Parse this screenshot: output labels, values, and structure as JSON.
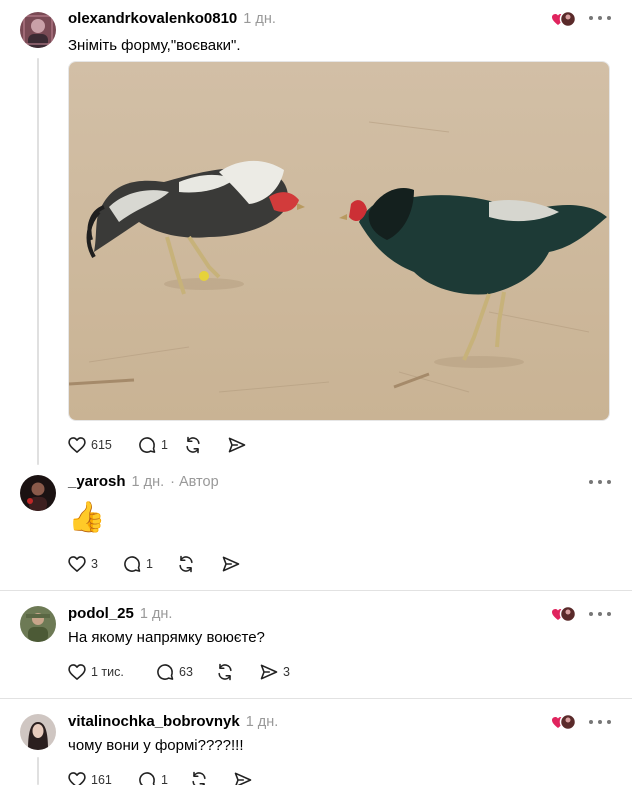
{
  "colors": {
    "username": "#000000",
    "meta": "#999999",
    "icon": "#222222",
    "heart_red": "#e0245e",
    "divider": "#e2e2e2"
  },
  "posts": [
    {
      "username": "olexandrkovalenko0810",
      "time": "1 дн.",
      "text": "Зніміть форму,\"воєваки\".",
      "image_alt": "two roosters fighting on sandy ground",
      "liked_by_author": true,
      "actions": {
        "likes": "615",
        "replies": "1",
        "reposts": "",
        "shares": ""
      }
    },
    {
      "username": "_yarosh",
      "time": "1 дн.",
      "author_tag": "· Автор",
      "emoji": "👍",
      "actions": {
        "likes": "3",
        "replies": "1",
        "reposts": "",
        "shares": ""
      }
    },
    {
      "username": "podol_25",
      "time": "1 дн.",
      "text": "На якому напрямку воюєте?",
      "liked_by_author": true,
      "actions": {
        "likes": "1 тис.",
        "replies": "63",
        "reposts": "",
        "shares": "3"
      }
    },
    {
      "username": "vitalinochka_bobrovnyk",
      "time": "1 дн.",
      "text": "чому вони у формі????!!!",
      "liked_by_author": true,
      "actions": {
        "likes": "161",
        "replies": "1",
        "reposts": "",
        "shares": ""
      }
    }
  ],
  "icons": [
    "heart-icon",
    "comment-icon",
    "repost-icon",
    "share-icon",
    "more-icon",
    "liked-by-author-icon"
  ]
}
